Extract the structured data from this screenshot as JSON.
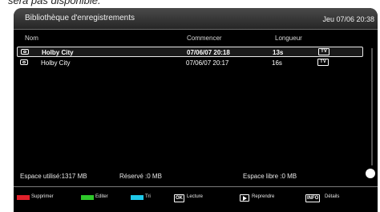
{
  "caption": "sera pas disponible.",
  "header": {
    "title": "Bibliothèque d'enregistrements",
    "clock": "Jeu 07/06 20:38"
  },
  "columns": {
    "name": "Nom",
    "start": "Commencer",
    "length": "Longueur"
  },
  "recordings": [
    {
      "name": "Holby City",
      "start": "07/06/07  20:18",
      "length": "13s",
      "badge": "TV",
      "selected": true
    },
    {
      "name": "Holby City",
      "start": "07/06/07  20:17",
      "length": "16s",
      "badge": "TV",
      "selected": false
    }
  ],
  "storage": {
    "used": "Espace utilisé:1317 MB",
    "reserved": "Réservé :0 MB",
    "free": "Espace libre :0 MB"
  },
  "legend": {
    "delete": {
      "label": "Supprimer",
      "color": "#e0202a"
    },
    "edit": {
      "label": "Editer",
      "color": "#2ec82a"
    },
    "sort": {
      "label": "Tri",
      "color": "#1ec8e8"
    },
    "play": {
      "key": "OK",
      "label": "Lecture"
    },
    "resume": {
      "label": "Reprendre"
    },
    "details": {
      "key": "INFO",
      "label": "Détails"
    }
  }
}
